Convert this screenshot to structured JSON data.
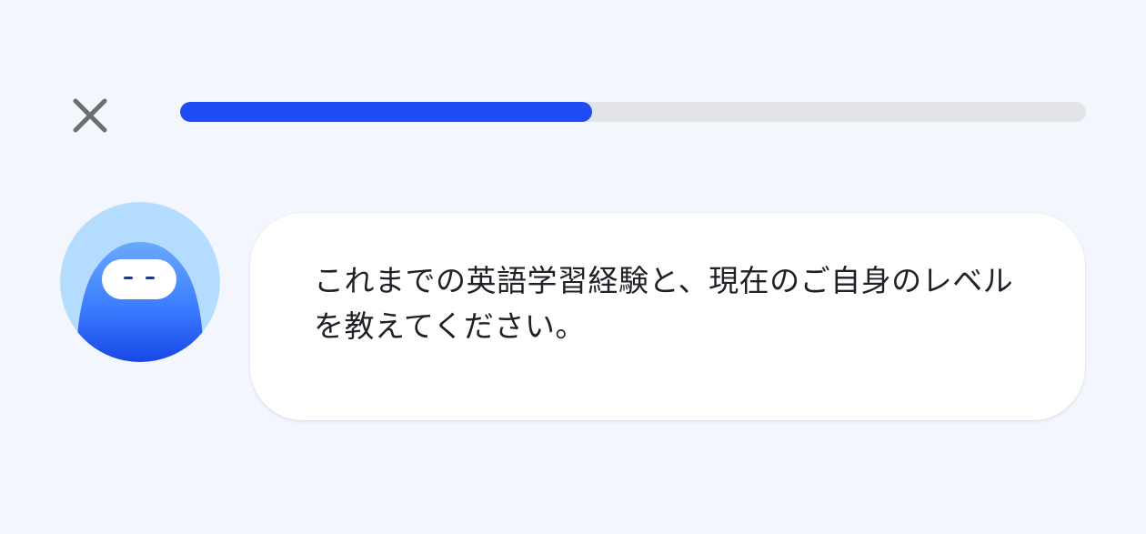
{
  "header": {
    "close_icon": "close-icon",
    "progress": {
      "value": 0.455,
      "fill_color": "#1f4cf6",
      "track_color": "#e3e4e8"
    }
  },
  "chat": {
    "avatar_icon": "robot-avatar-icon",
    "message": "これまでの英語学習経験と、現在のご自身のレベルを教えてください。"
  }
}
